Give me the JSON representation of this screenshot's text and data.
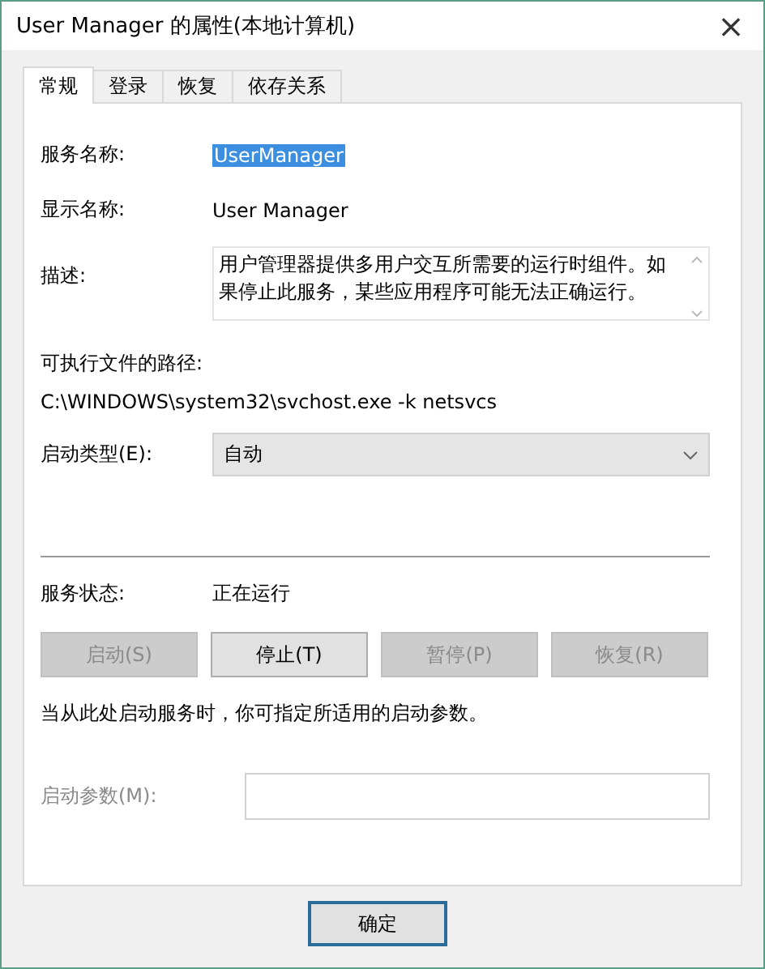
{
  "window": {
    "title": "User Manager 的属性(本地计算机)",
    "close": "×"
  },
  "tabs": [
    {
      "label": "常规",
      "selected": true
    },
    {
      "label": "登录",
      "selected": false
    },
    {
      "label": "恢复",
      "selected": false
    },
    {
      "label": "依存关系",
      "selected": false
    }
  ],
  "service_name": {
    "label": "服务名称:",
    "value": "UserManager",
    "selected": true
  },
  "display_name": {
    "label": "显示名称:",
    "value": "User Manager"
  },
  "description": {
    "label": "描述:",
    "value": "用户管理器提供多用户交互所需要的运行时组件。如果停止此服务，某些应用程序可能无法正确运行。"
  },
  "executable_path": {
    "label": "可执行文件的路径:",
    "value": "C:\\WINDOWS\\system32\\svchost.exe -k netsvcs"
  },
  "startup_type": {
    "label": "启动类型(E):",
    "value": "自动"
  },
  "service_status": {
    "label": "服务状态:",
    "value": "正在运行"
  },
  "service_buttons": [
    {
      "label": "启动(S)",
      "disabled": true
    },
    {
      "label": "停止(T)",
      "disabled": false
    },
    {
      "label": "暂停(P)",
      "disabled": true
    },
    {
      "label": "恢复(R)",
      "disabled": true
    }
  ],
  "hint": "当从此处启动服务时，你可指定所适用的启动参数。",
  "start_parameters": {
    "label": "启动参数(M):",
    "disabled": true
  },
  "footer_buttons": [
    {
      "label": "确定",
      "default": true
    }
  ]
}
